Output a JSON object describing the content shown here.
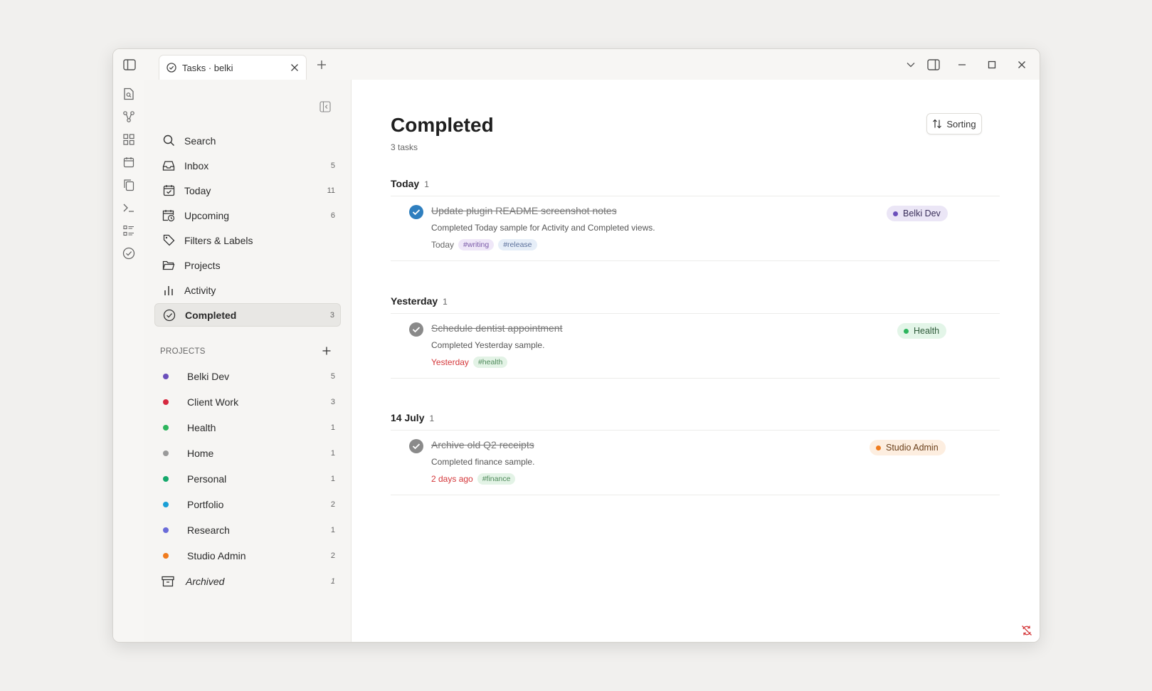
{
  "tab": {
    "title": "Tasks · belki"
  },
  "nav": [
    {
      "label": "Search",
      "count": ""
    },
    {
      "label": "Inbox",
      "count": "5"
    },
    {
      "label": "Today",
      "count": "11"
    },
    {
      "label": "Upcoming",
      "count": "6"
    },
    {
      "label": "Filters & Labels",
      "count": ""
    },
    {
      "label": "Projects",
      "count": ""
    },
    {
      "label": "Activity",
      "count": ""
    },
    {
      "label": "Completed",
      "count": "3"
    }
  ],
  "projects_header": "PROJECTS",
  "projects": [
    {
      "name": "Belki Dev",
      "count": "5",
      "color": "#6b4fbb"
    },
    {
      "name": "Client Work",
      "count": "3",
      "color": "#d6283f"
    },
    {
      "name": "Health",
      "count": "1",
      "color": "#2db55d"
    },
    {
      "name": "Home",
      "count": "1",
      "color": "#9a9a9a"
    },
    {
      "name": "Personal",
      "count": "1",
      "color": "#14a86b"
    },
    {
      "name": "Portfolio",
      "count": "2",
      "color": "#1a9fd6"
    },
    {
      "name": "Research",
      "count": "1",
      "color": "#6a6bd9"
    },
    {
      "name": "Studio Admin",
      "count": "2",
      "color": "#f07b1d"
    }
  ],
  "archived": {
    "label": "Archived",
    "count": "1"
  },
  "main": {
    "title": "Completed",
    "subtitle": "3 tasks",
    "sort_label": "Sorting"
  },
  "groups": [
    {
      "label": "Today",
      "count": "1",
      "task": {
        "title": "Update plugin README screenshot notes",
        "description": "Completed Today sample for Activity and Completed views.",
        "date": "Today",
        "date_color": "#666666",
        "check_color": "#2f7fbf",
        "tags": [
          {
            "text": "#writing",
            "bg": "#efe7f8",
            "fg": "#7a5aa8"
          },
          {
            "text": "#release",
            "bg": "#e6eef8",
            "fg": "#5a6f9a"
          }
        ],
        "project": "Belki Dev",
        "project_dot": "#6b4fbb",
        "project_bg": "#ebe6f6",
        "project_fg": "#3a2f5a"
      }
    },
    {
      "label": "Yesterday",
      "count": "1",
      "task": {
        "title": "Schedule dentist appointment",
        "description": "Completed Yesterday sample.",
        "date": "Yesterday",
        "date_color": "#d4373a",
        "check_color": "#8a8a8a",
        "tags": [
          {
            "text": "#health",
            "bg": "#e3f3e6",
            "fg": "#4f8a5b"
          }
        ],
        "project": "Health",
        "project_dot": "#2db55d",
        "project_bg": "#e3f5e8",
        "project_fg": "#2f5a3a"
      }
    },
    {
      "label": "14 July",
      "count": "1",
      "task": {
        "title": "Archive old Q2 receipts",
        "description": "Completed finance sample.",
        "date": "2 days ago",
        "date_color": "#d4373a",
        "check_color": "#8a8a8a",
        "tags": [
          {
            "text": "#finance",
            "bg": "#e3f3e6",
            "fg": "#4f8a5b"
          }
        ],
        "project": "Studio Admin",
        "project_dot": "#f07b1d",
        "project_bg": "#fdeee0",
        "project_fg": "#6a3f1a"
      }
    }
  ]
}
